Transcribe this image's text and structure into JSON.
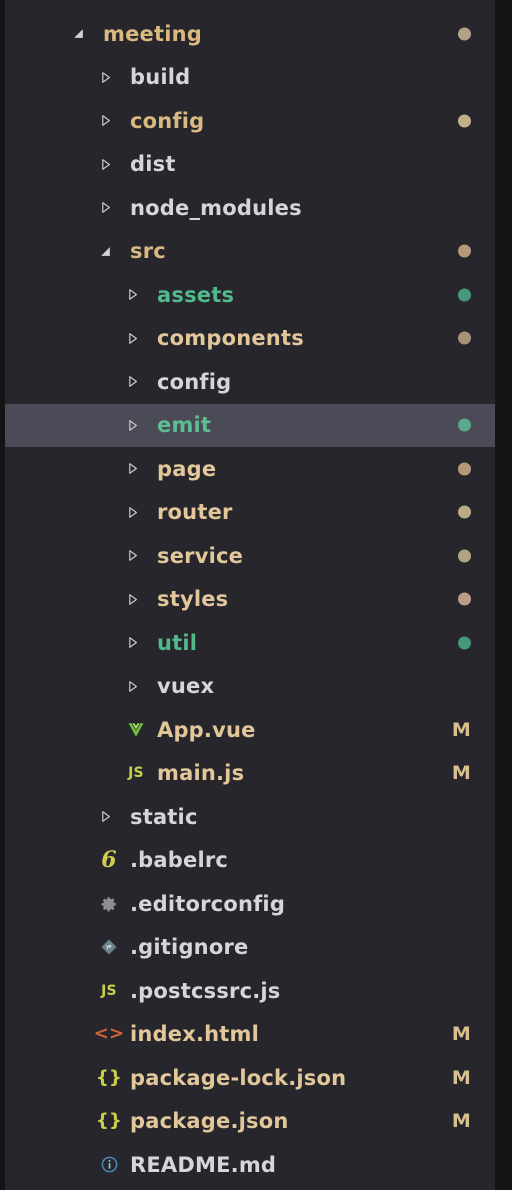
{
  "theme": {
    "background": "#26262c",
    "gutter": "#141417",
    "selected_row_background": "#4b4b58",
    "folder_gold": "#d8b97f",
    "folder_green": "#52b98a",
    "text_white": "#d6d6da",
    "file_tan": "#e2c79a",
    "marker_color": "#d7c08e"
  },
  "explorer": {
    "name": "file-explorer-tree",
    "root": "meeting",
    "selected_item": "emit",
    "items": [
      {
        "label": "meeting",
        "depth": 0,
        "kind": "folder",
        "state": "expanded",
        "color": "#d8b97f",
        "bold": true,
        "dot": "#b2a285",
        "marker": ""
      },
      {
        "label": "build",
        "depth": 1,
        "kind": "folder",
        "state": "collapsed",
        "color": "#d6d6da",
        "bold": true,
        "dot": "",
        "marker": ""
      },
      {
        "label": "config",
        "depth": 1,
        "kind": "folder",
        "state": "collapsed",
        "color": "#d8b97f",
        "bold": true,
        "dot": "#c0b087",
        "marker": ""
      },
      {
        "label": "dist",
        "depth": 1,
        "kind": "folder",
        "state": "collapsed",
        "color": "#d6d6da",
        "bold": true,
        "dot": "",
        "marker": ""
      },
      {
        "label": "node_modules",
        "depth": 1,
        "kind": "folder",
        "state": "collapsed",
        "color": "#d6d6da",
        "bold": true,
        "dot": "",
        "marker": ""
      },
      {
        "label": "src",
        "depth": 1,
        "kind": "folder",
        "state": "expanded",
        "color": "#d8b97f",
        "bold": true,
        "dot": "#b59977",
        "marker": ""
      },
      {
        "label": "assets",
        "depth": 2,
        "kind": "folder",
        "state": "collapsed",
        "color": "#52b98a",
        "bold": true,
        "dot": "#45997a",
        "marker": ""
      },
      {
        "label": "components",
        "depth": 2,
        "kind": "folder",
        "state": "collapsed",
        "color": "#e2c79a",
        "bold": true,
        "dot": "#a89377",
        "marker": ""
      },
      {
        "label": "config",
        "depth": 2,
        "kind": "folder",
        "state": "collapsed",
        "color": "#d6d6da",
        "bold": true,
        "dot": "",
        "marker": ""
      },
      {
        "label": "emit",
        "depth": 2,
        "kind": "folder",
        "state": "collapsed",
        "color": "#5cbd90",
        "bold": true,
        "dot": "#5aa98a",
        "marker": "",
        "selected": true
      },
      {
        "label": "page",
        "depth": 2,
        "kind": "folder",
        "state": "collapsed",
        "color": "#e2c79a",
        "bold": true,
        "dot": "#b59977",
        "marker": ""
      },
      {
        "label": "router",
        "depth": 2,
        "kind": "folder",
        "state": "collapsed",
        "color": "#e2c79a",
        "bold": true,
        "dot": "#bbab84",
        "marker": ""
      },
      {
        "label": "service",
        "depth": 2,
        "kind": "folder",
        "state": "collapsed",
        "color": "#e2c79a",
        "bold": true,
        "dot": "#b0a383",
        "marker": ""
      },
      {
        "label": "styles",
        "depth": 2,
        "kind": "folder",
        "state": "collapsed",
        "color": "#e2c79a",
        "bold": true,
        "dot": "#bb9d8a",
        "marker": ""
      },
      {
        "label": "util",
        "depth": 2,
        "kind": "folder",
        "state": "collapsed",
        "color": "#52b98a",
        "bold": true,
        "dot": "#45997a",
        "marker": ""
      },
      {
        "label": "vuex",
        "depth": 2,
        "kind": "folder",
        "state": "collapsed",
        "color": "#d6d6da",
        "bold": true,
        "dot": "",
        "marker": ""
      },
      {
        "label": "App.vue",
        "depth": 2,
        "kind": "file",
        "icon": "vue-icon",
        "color": "#e2c79a",
        "bold": true,
        "dot": "",
        "marker": "M"
      },
      {
        "label": "main.js",
        "depth": 2,
        "kind": "file",
        "icon": "js-icon",
        "color": "#e2c79a",
        "bold": true,
        "dot": "",
        "marker": "M"
      },
      {
        "label": "static",
        "depth": 1,
        "kind": "folder",
        "state": "collapsed",
        "color": "#d6d6da",
        "bold": true,
        "dot": "",
        "marker": ""
      },
      {
        "label": ".babelrc",
        "depth": 1,
        "kind": "file",
        "icon": "babel-icon",
        "color": "#d6d6da",
        "bold": true,
        "dot": "",
        "marker": ""
      },
      {
        "label": ".editorconfig",
        "depth": 1,
        "kind": "file",
        "icon": "gear-icon",
        "color": "#d6d6da",
        "bold": true,
        "dot": "",
        "marker": ""
      },
      {
        "label": ".gitignore",
        "depth": 1,
        "kind": "file",
        "icon": "git-icon",
        "color": "#d6d6da",
        "bold": true,
        "dot": "",
        "marker": ""
      },
      {
        "label": ".postcssrc.js",
        "depth": 1,
        "kind": "file",
        "icon": "js-icon",
        "color": "#d6d6da",
        "bold": true,
        "dot": "",
        "marker": ""
      },
      {
        "label": "index.html",
        "depth": 1,
        "kind": "file",
        "icon": "html-icon",
        "color": "#e2c79a",
        "bold": true,
        "dot": "",
        "marker": "M"
      },
      {
        "label": "package-lock.json",
        "depth": 1,
        "kind": "file",
        "icon": "json-icon",
        "color": "#e2c79a",
        "bold": true,
        "dot": "",
        "marker": "M"
      },
      {
        "label": "package.json",
        "depth": 1,
        "kind": "file",
        "icon": "json-icon",
        "color": "#e2c79a",
        "bold": true,
        "dot": "",
        "marker": "M"
      },
      {
        "label": "README.md",
        "depth": 1,
        "kind": "file",
        "icon": "markdown-info-icon",
        "color": "#d6d6da",
        "bold": true,
        "dot": "",
        "marker": ""
      }
    ]
  }
}
